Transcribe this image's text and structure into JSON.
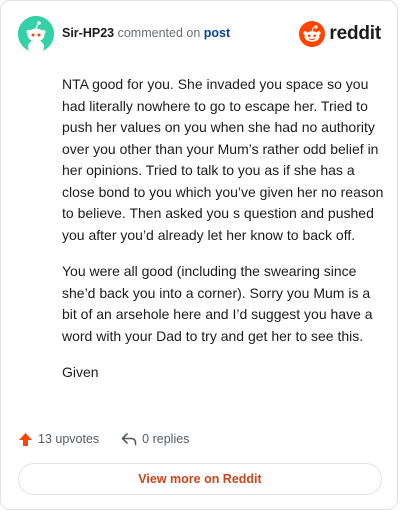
{
  "header": {
    "username": "Sir-HP23",
    "action_text": "commented on",
    "post_link": "post",
    "brand": "reddit"
  },
  "comment": {
    "paragraphs": [
      "NTA good for you. She invaded you space so you had literally nowhere to go to escape her. Tried to push her values on you when she had no authority over you other than your Mum’s rather odd belief in her opinions. Tried to talk to you as if she has a close bond to you which you’ve given her no reason to believe. Then asked you s question and pushed you after you’d already let her know to back off.",
      "You were all good (including the swearing since she’d back you into a corner). Sorry you Mum is a bit of an arsehole here and I’d suggest you have a word with your Dad to try and get her to see this.",
      "Given"
    ]
  },
  "stats": {
    "upvotes": "13 upvotes",
    "replies": "0 replies"
  },
  "footer": {
    "view_more": "View more on Reddit"
  },
  "colors": {
    "avatar": "#34d0a8",
    "brand_orange": "#ff4500",
    "upvote_arrow": "#ff4500",
    "link_blue": "#0a449b",
    "button_text": "#c8461e"
  },
  "icons": {
    "avatar": "snoo-avatar-icon",
    "brand": "reddit-logo-icon",
    "upvote": "upvote-arrow-icon",
    "reply": "reply-arrow-icon"
  }
}
